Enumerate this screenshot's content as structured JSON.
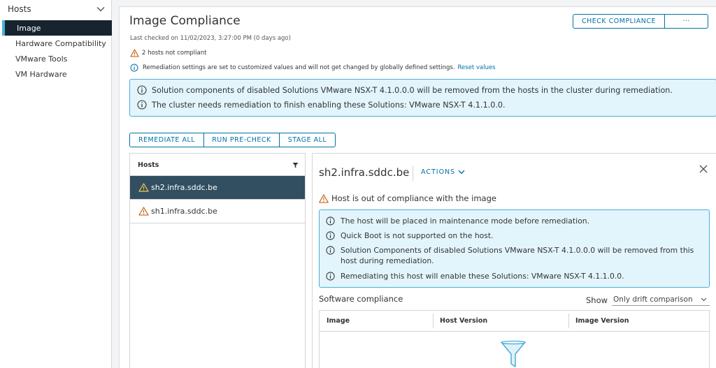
{
  "sidebar": {
    "header": "Hosts",
    "items": [
      {
        "label": "Image"
      },
      {
        "label": "Hardware Compatibility"
      },
      {
        "label": "VMware Tools"
      },
      {
        "label": "VM Hardware"
      }
    ]
  },
  "main": {
    "title": "Image Compliance",
    "check_compliance_label": "CHECK COMPLIANCE",
    "more_label": "···",
    "last_checked": "Last checked on 11/02/2023, 3:27:00 PM (0 days ago)",
    "noncompliant_text": "2 hosts not compliant",
    "remediation_note": "Remediation settings are set to customized values and will not get changed by globally defined settings.",
    "reset_link": "Reset values",
    "info_messages": [
      "Solution components of disabled Solutions VMware NSX-T 4.1.0.0.0 will be removed from the hosts in the cluster during remediation.",
      "The cluster needs remediation to finish enabling these Solutions: VMware NSX-T 4.1.1.0.0."
    ],
    "actions": {
      "remediate_all": "REMEDIATE ALL",
      "run_precheck": "RUN PRE-CHECK",
      "stage_all": "STAGE ALL"
    }
  },
  "hosts_list": {
    "header": "Hosts",
    "rows": [
      {
        "name": "sh2.infra.sddc.be",
        "selected": true
      },
      {
        "name": "sh1.infra.sddc.be",
        "selected": false
      }
    ]
  },
  "detail": {
    "host_name": "sh2.infra.sddc.be",
    "actions_label": "ACTIONS",
    "warning": "Host is out of compliance with the image",
    "info_messages": [
      "The host will be placed in maintenance mode before remediation.",
      "Quick Boot is not supported on the host.",
      "Solution Components of disabled Solutions VMware NSX-T 4.1.0.0.0 will be removed from this host during remediation.",
      "Remediating this host will enable these Solutions: VMware NSX-T 4.1.1.0.0."
    ],
    "software_compliance_title": "Software compliance",
    "show_label": "Show",
    "show_value": "Only drift comparison",
    "table_headers": [
      "Image",
      "Host Version",
      "Image Version"
    ]
  },
  "colors": {
    "accent": "#0072a3",
    "sidebar_active": "#17242f",
    "selected_row": "#324f61",
    "info_bg": "#e3f5fc",
    "info_border": "#49afd9",
    "warning": "#c25400"
  }
}
